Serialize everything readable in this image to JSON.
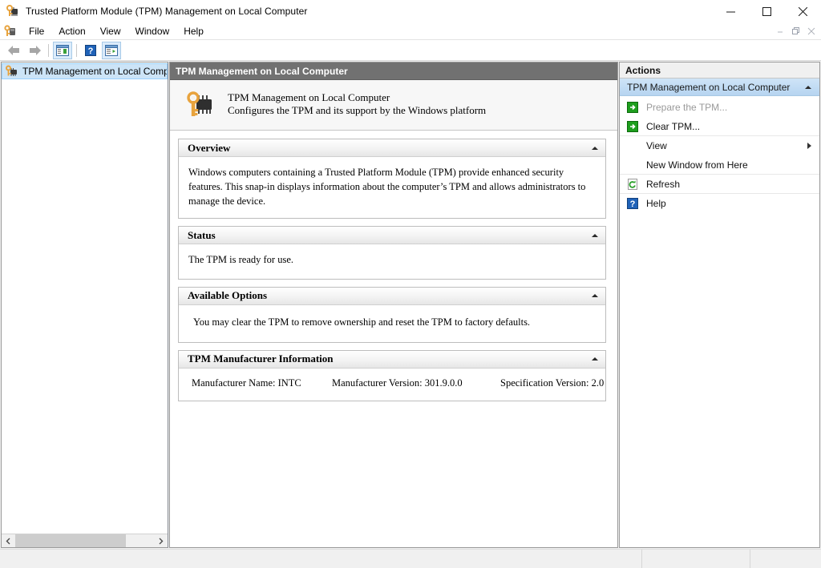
{
  "window": {
    "title": "Trusted Platform Module (TPM) Management on Local Computer",
    "icon": "tpm-key-chip-icon",
    "controls": {
      "minimize": "minimize-icon",
      "maximize": "maximize-icon",
      "close": "close-icon"
    },
    "mdi_controls": {
      "minimize": "mdi-minimize-icon",
      "restore": "mdi-restore-icon",
      "close": "mdi-close-icon"
    }
  },
  "menubar": {
    "icon": "tpm-key-chip-icon",
    "items": [
      {
        "label": "File"
      },
      {
        "label": "Action"
      },
      {
        "label": "View"
      },
      {
        "label": "Window"
      },
      {
        "label": "Help"
      }
    ]
  },
  "toolbar": {
    "buttons": [
      {
        "name": "back-button",
        "icon": "arrow-left-icon"
      },
      {
        "name": "forward-button",
        "icon": "arrow-right-icon"
      },
      {
        "name": "show-hide-console-tree-button",
        "icon": "console-tree-icon"
      },
      {
        "name": "help-button",
        "icon": "question-mark-icon"
      },
      {
        "name": "show-hide-action-pane-button",
        "icon": "action-pane-icon"
      }
    ]
  },
  "tree": {
    "items": [
      {
        "label": "TPM Management on Local Comp",
        "icon": "tpm-key-chip-icon",
        "selected": true
      }
    ],
    "scrollbar": {
      "left_arrow": "chevron-left-icon",
      "right_arrow": "chevron-right-icon"
    }
  },
  "main": {
    "header": "TPM Management on Local Computer",
    "banner": {
      "icon": "tpm-key-chip-large-icon",
      "title": "TPM Management on Local Computer",
      "subtitle": "Configures the TPM and its support by the Windows platform"
    },
    "sections": [
      {
        "id": "overview",
        "title": "Overview",
        "collapse_icon": "chevron-up-icon",
        "body": "Windows computers containing a Trusted Platform Module (TPM) provide enhanced security features. This snap-in displays information about the computer’s TPM and allows administrators to manage the device."
      },
      {
        "id": "status",
        "title": "Status",
        "collapse_icon": "chevron-up-icon",
        "body": "The TPM is ready for use."
      },
      {
        "id": "available-options",
        "title": "Available Options",
        "collapse_icon": "chevron-up-icon",
        "body": "You may clear the TPM to remove ownership and reset the TPM to factory defaults."
      },
      {
        "id": "tpm-manufacturer-information",
        "title": "TPM Manufacturer Information",
        "collapse_icon": "chevron-up-icon",
        "fields": [
          {
            "label": "Manufacturer Name:",
            "value": "INTC"
          },
          {
            "label": "Manufacturer Version:",
            "value": "301.9.0.0"
          },
          {
            "label": "Specification Version:",
            "value": "2.0"
          }
        ]
      }
    ]
  },
  "actions": {
    "header": "Actions",
    "group": {
      "label": "TPM Management on Local Computer",
      "collapse_icon": "chevron-up-icon"
    },
    "items": [
      {
        "label": "Prepare the TPM...",
        "icon": "green-arrow-icon",
        "disabled": true
      },
      {
        "label": "Clear TPM...",
        "icon": "green-arrow-icon",
        "disabled": false
      },
      {
        "label": "View",
        "icon": "none",
        "disabled": false,
        "submenu": true
      },
      {
        "label": "New Window from Here",
        "icon": "none",
        "disabled": false
      },
      {
        "label": "Refresh",
        "icon": "refresh-icon",
        "disabled": false
      },
      {
        "label": "Help",
        "icon": "question-mark-icon",
        "disabled": false
      }
    ]
  },
  "statusbar": {
    "panes": [
      "",
      "",
      ""
    ]
  },
  "colors": {
    "header_grey": "#717171",
    "selection_blue": "#cce4f7",
    "action_group_blue": "#c2dcf4",
    "green_arrow": "#1e9e1e",
    "help_blue": "#1f62b8",
    "key_gold": "#e8a33d"
  }
}
